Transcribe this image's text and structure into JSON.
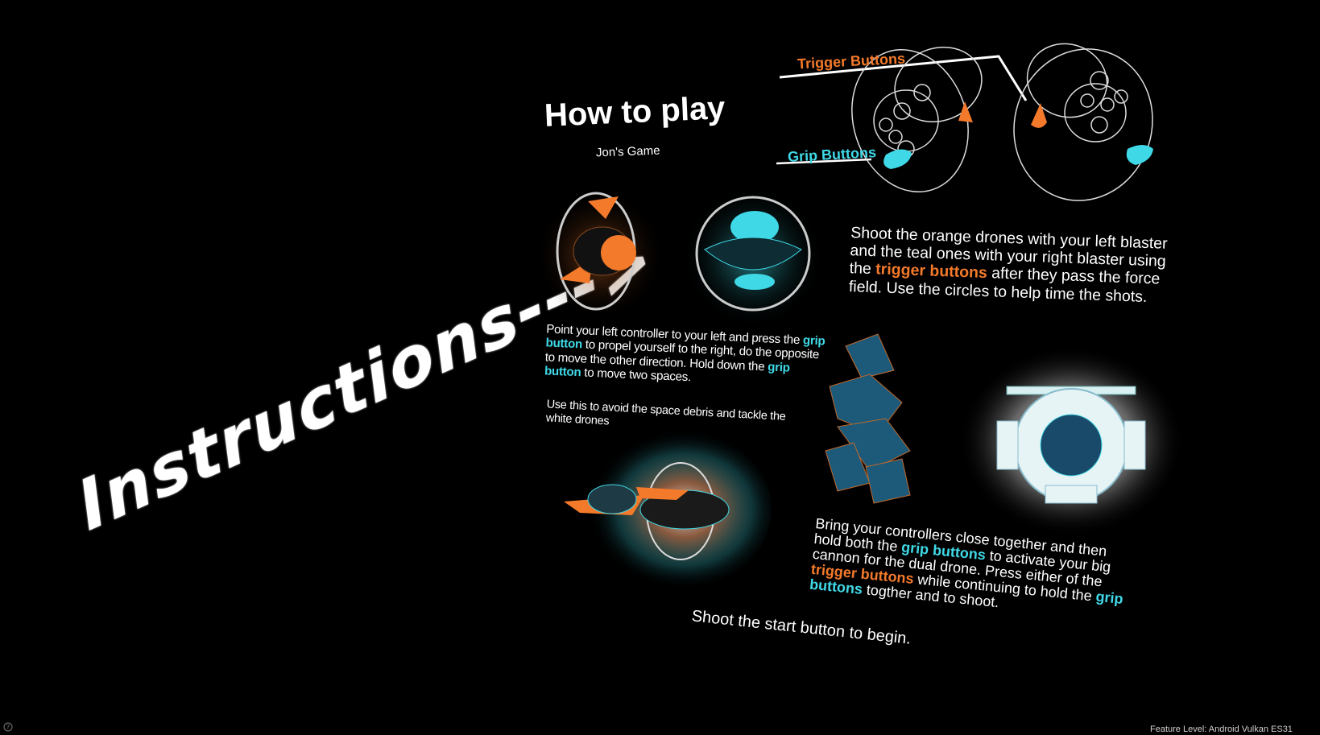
{
  "world": {
    "instructions_text": "Instructions--->"
  },
  "board": {
    "title": "How to play",
    "subtitle": "Jon's Game",
    "labels": {
      "trigger": "Trigger Buttons",
      "grip": "Grip Buttons"
    },
    "shoot": {
      "part1": "Shoot the orange drones with your left blaster and the teal ones with your right blaster using the ",
      "highlight": "trigger buttons",
      "part2": " after they pass the force field. Use the circles to help time the shots."
    },
    "grip": {
      "part1": "Point your left controller to your left and press the ",
      "highlight1": "grip button",
      "part2": " to propel yourself to the right, do the opposite to move the other direction. Hold down the ",
      "highlight2": "grip button",
      "part3": " to move two spaces."
    },
    "debris": "Use this to avoid the space debris and tackle the white drones",
    "dual": {
      "part1": "Bring your controllers close together and then hold both the ",
      "grip_highlight1": "grip buttons",
      "part2": " to activate your big cannon for the dual drone. Press either of the ",
      "trigger_highlight": "trigger buttons",
      "part3": " while continuing to hold the ",
      "grip_highlight2": "grip buttons",
      "part4": " togther and to shoot."
    },
    "start": "Shoot the start button to begin."
  },
  "hud": {
    "feature_level": "Feature Level:  Android Vulkan ES31",
    "help_icon": "help-icon"
  },
  "colors": {
    "orange": "#f47a2b",
    "teal": "#3fd8e6",
    "background": "#000000"
  }
}
